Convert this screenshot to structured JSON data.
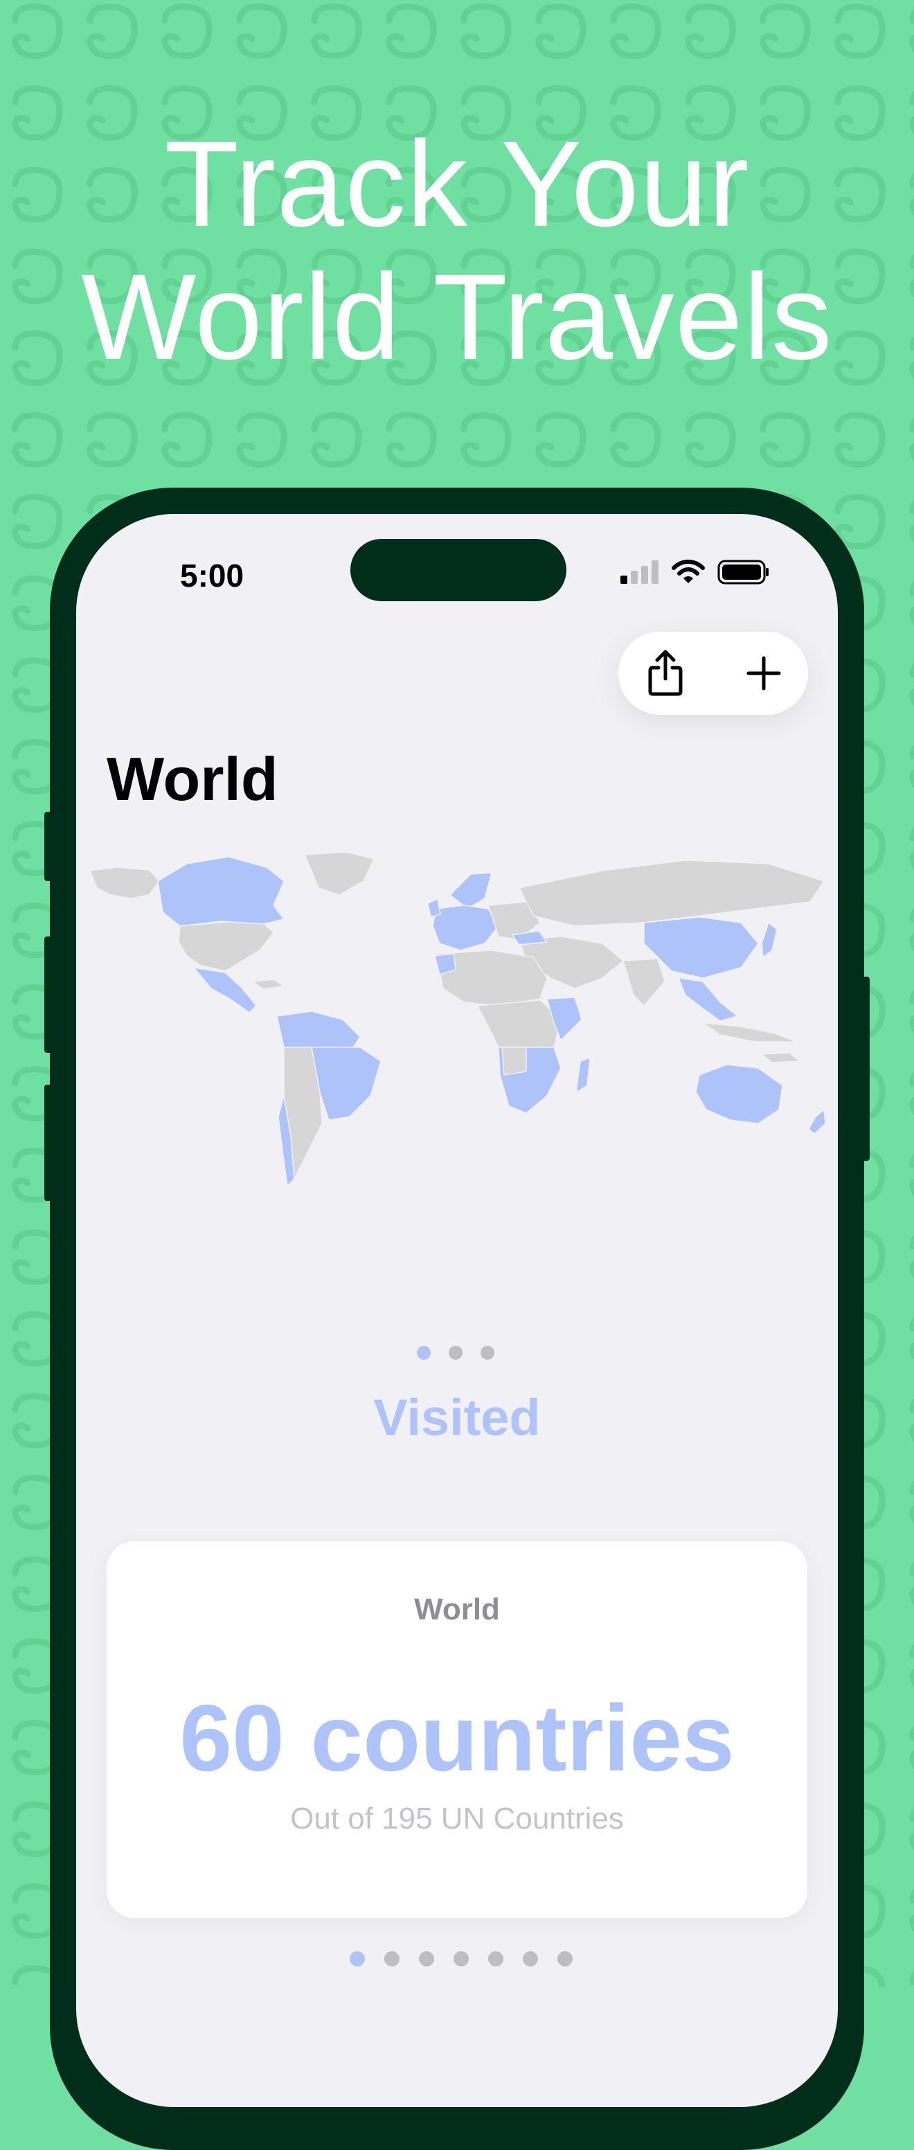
{
  "headline": {
    "line1": "Track Your",
    "line2": "World Travels"
  },
  "colors": {
    "background": "#6fdfa2",
    "pattern": "#62d292",
    "phone_frame": "#002e1b",
    "screen_bg": "#f1f1f5",
    "visited": "#adc3fa",
    "not_visited": "#d6d6d6",
    "dot_inactive": "#bdbdc2",
    "subtext": "#c4c4c8"
  },
  "status_bar": {
    "time": "5:00",
    "icons": [
      "cellular-signal-icon",
      "wifi-icon",
      "battery-icon"
    ]
  },
  "toolbar": {
    "buttons": [
      {
        "icon": "share-icon",
        "name": "share-button"
      },
      {
        "icon": "plus-icon",
        "name": "add-button"
      }
    ]
  },
  "screen": {
    "title": "World",
    "map_carousel": {
      "page_count": 3,
      "active_index": 0
    },
    "visited_label": "Visited",
    "stats_card": {
      "region": "World",
      "count_text": "60 countries",
      "subtitle": "Out of 195 UN Countries"
    },
    "card_carousel": {
      "page_count": 7,
      "active_index": 0
    }
  }
}
